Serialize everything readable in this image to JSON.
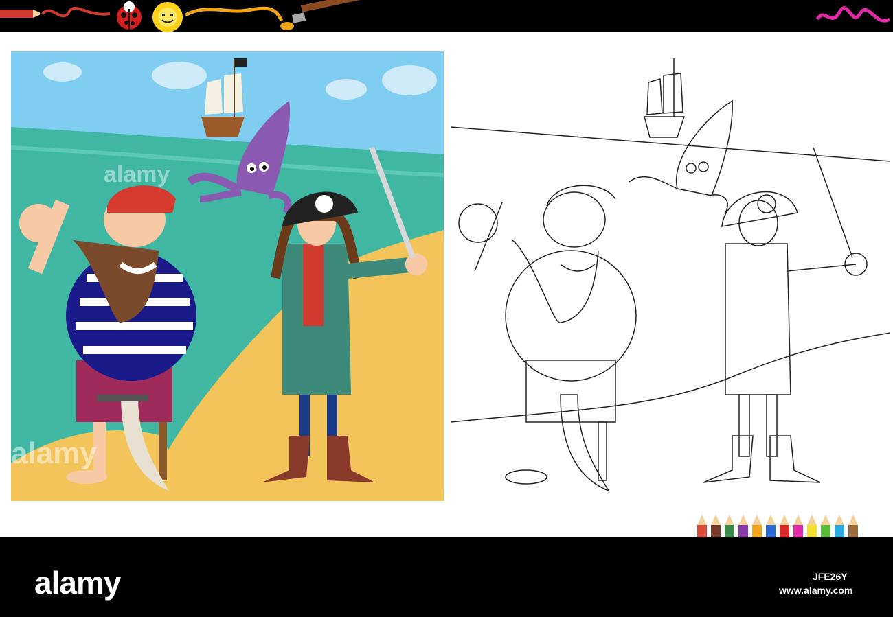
{
  "footer": {
    "brand_logo": "alamy",
    "image_id": "JFE26Y",
    "site_url": "www.alamy.com"
  },
  "watermarks": {
    "text": "alamy",
    "small": "a"
  },
  "colors": {
    "bar": "#000000",
    "sky": "#7fcdf0",
    "sea": "#3fb7a3",
    "sand": "#f3c45a",
    "squid": "#8a5ab0",
    "bandana": "#d63a2f",
    "coat": "#3d8a7a"
  },
  "icons": [
    "pencil-icon",
    "ladybug-icon",
    "sun-icon",
    "paintbrush-icon",
    "crayon-squiggle-icon",
    "colored-pencils-icon"
  ]
}
